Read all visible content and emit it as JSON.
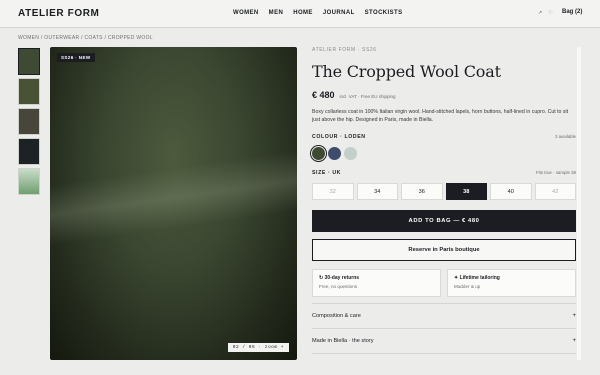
{
  "header": {
    "logo": "ATELIER FORM",
    "nav": [
      "WOMEN",
      "MEN",
      "HOME",
      "JOURNAL",
      "STOCKISTS"
    ],
    "icons": [
      "search-icon",
      "heart-icon"
    ],
    "bag_label": "Bag (2)"
  },
  "breadcrumb": "WOMEN / OUTERWEAR / COATS / CROPPED WOOL",
  "gallery": {
    "thumbnail_colors": [
      "#3e4a33",
      "#4a5236",
      "#48463a",
      "#1d2224",
      "#8fb98f"
    ],
    "badge": "SS26 · NEW",
    "counter": "02 / 05 · zoom +"
  },
  "product": {
    "eyebrow": "ATELIER FORM · SS26",
    "title": "The Cropped Wool Coat",
    "price": "€ 480",
    "vat_note": "incl. VAT · Free EU shipping",
    "description": "Boxy collarless coat in 100% Italian virgin wool. Hand-stitched lapels, horn buttons, half-lined in cupro. Cut to sit just above the hip. Designed in Paris, made in Biella.",
    "colour_label": "COLOUR · LODEN",
    "colour_available": "3 available",
    "swatches": [
      {
        "name": "loden",
        "color": "#3f4a33",
        "selected": true
      },
      {
        "name": "navy",
        "color": "#3d4d6b",
        "selected": false
      },
      {
        "name": "sage",
        "color": "#c3cfc9",
        "selected": false
      }
    ],
    "size_label": "SIZE · UK",
    "size_note": "Fits true · sample 38",
    "sizes": [
      {
        "label": "32",
        "state": "disabled"
      },
      {
        "label": "34",
        "state": "available"
      },
      {
        "label": "36",
        "state": "available"
      },
      {
        "label": "38",
        "state": "selected"
      },
      {
        "label": "40",
        "state": "available"
      },
      {
        "label": "42",
        "state": "disabled"
      }
    ],
    "add_to_bag": "ADD TO BAG — € 480",
    "reserve": "Reserve in Paris boutique",
    "cards": [
      {
        "title": "↻ 30-day returns",
        "sub": "Free, no questions"
      },
      {
        "title": "✦ Lifetime tailoring",
        "sub": "Madder & up"
      }
    ],
    "accordion": [
      {
        "label": "Composition & care",
        "icon": "+"
      },
      {
        "label": "Made in Biella · the story",
        "icon": "+"
      }
    ]
  },
  "colors": {
    "ink": "#1b1d22",
    "background": "#ecedea",
    "header_bg": "#f3f4f1"
  }
}
